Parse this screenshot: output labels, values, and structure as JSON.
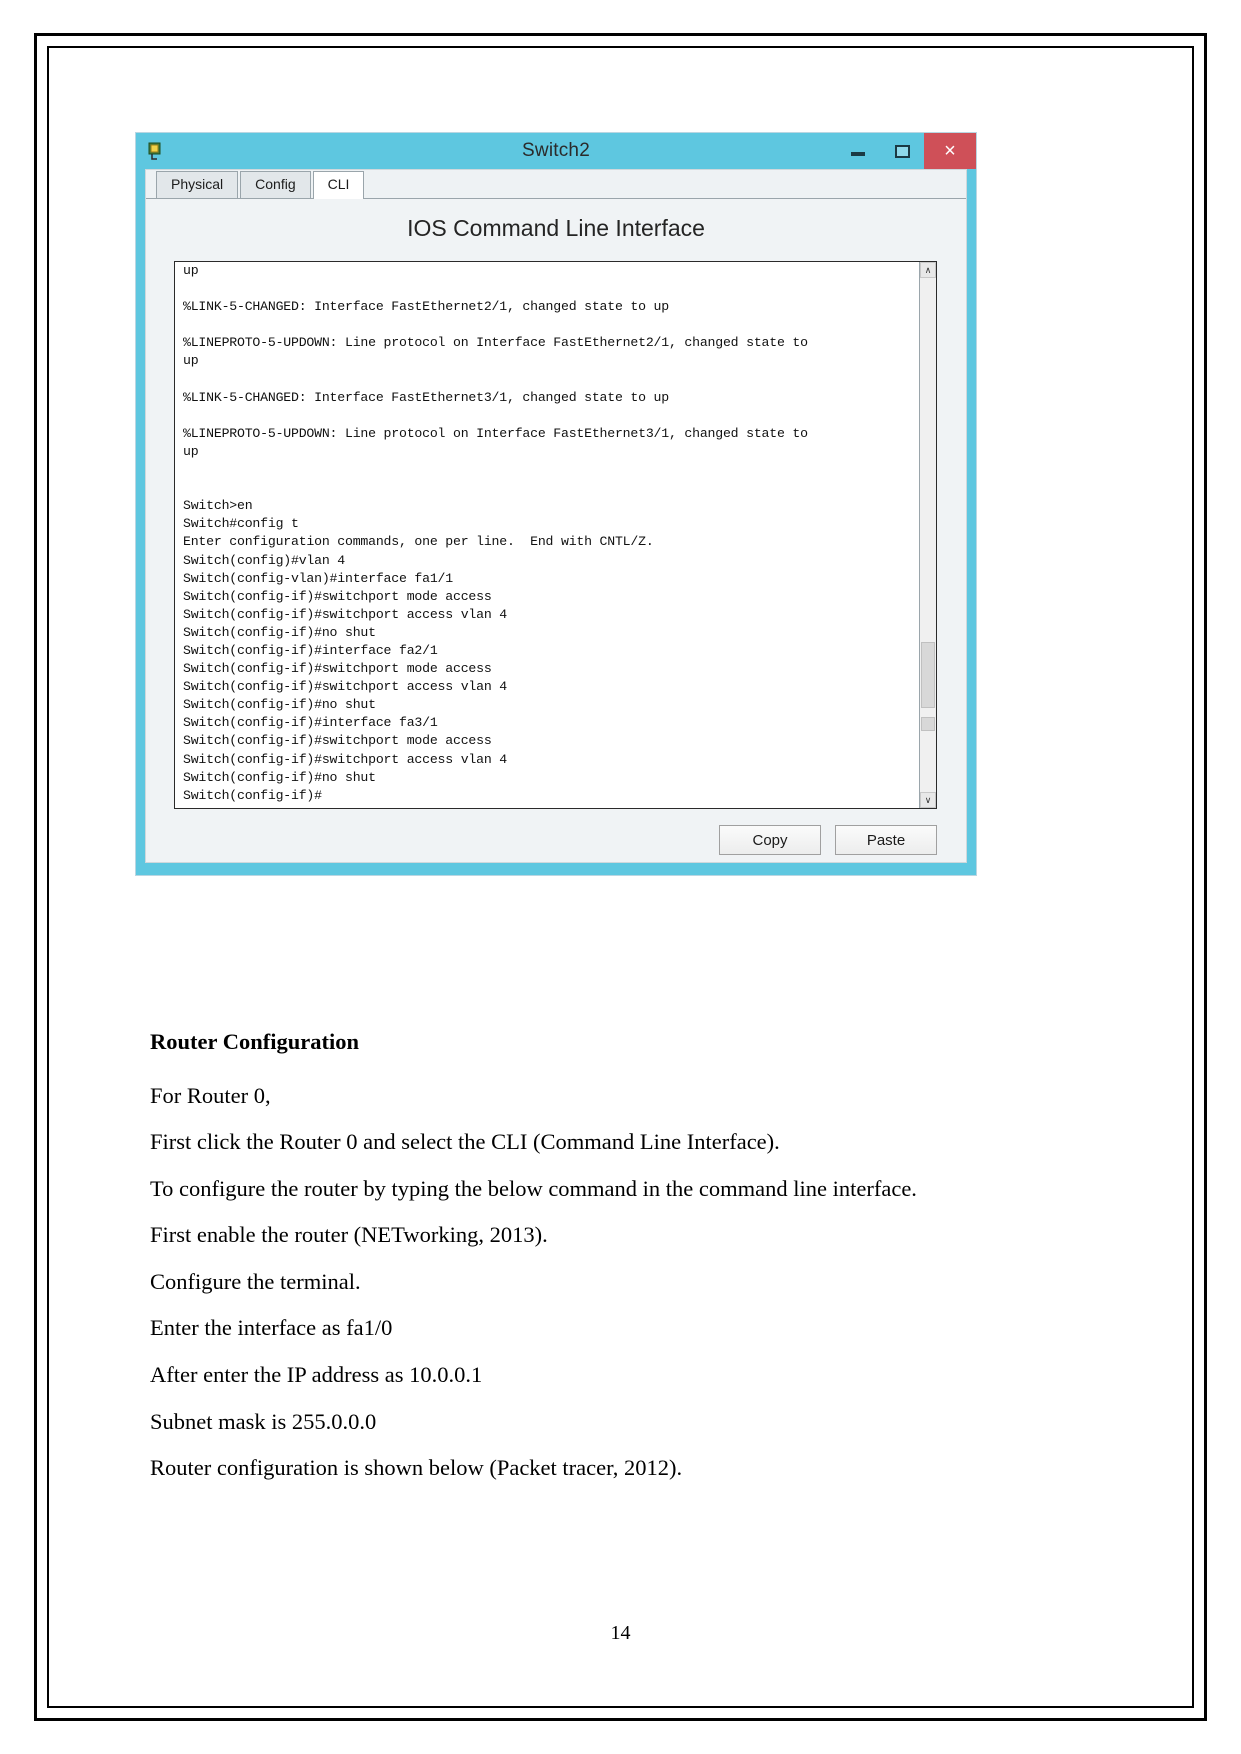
{
  "window": {
    "title": "Switch2",
    "icon": "packet-tracer-switch-icon",
    "controls": {
      "minimize": "–",
      "maximize": "□",
      "close": "×",
      "close_color": "#cf5058"
    },
    "titlebar_color": "#5ec7e0"
  },
  "tabs": [
    {
      "label": "Physical",
      "active": false
    },
    {
      "label": "Config",
      "active": false
    },
    {
      "label": "CLI",
      "active": true
    }
  ],
  "cli": {
    "heading": "IOS Command Line Interface",
    "terminal_text": "up\n\n%LINK-5-CHANGED: Interface FastEthernet2/1, changed state to up\n\n%LINEPROTO-5-UPDOWN: Line protocol on Interface FastEthernet2/1, changed state to\nup\n\n%LINK-5-CHANGED: Interface FastEthernet3/1, changed state to up\n\n%LINEPROTO-5-UPDOWN: Line protocol on Interface FastEthernet3/1, changed state to\nup\n\n\nSwitch>en\nSwitch#config t\nEnter configuration commands, one per line.  End with CNTL/Z.\nSwitch(config)#vlan 4\nSwitch(config-vlan)#interface fa1/1\nSwitch(config-if)#switchport mode access\nSwitch(config-if)#switchport access vlan 4\nSwitch(config-if)#no shut\nSwitch(config-if)#interface fa2/1\nSwitch(config-if)#switchport mode access\nSwitch(config-if)#switchport access vlan 4\nSwitch(config-if)#no shut\nSwitch(config-if)#interface fa3/1\nSwitch(config-if)#switchport mode access\nSwitch(config-if)#switchport access vlan 4\nSwitch(config-if)#no shut\nSwitch(config-if)#",
    "scrollbar": {
      "up_arrow": "∧",
      "down_arrow": "∨"
    },
    "buttons": {
      "copy": "Copy",
      "paste": "Paste"
    }
  },
  "article": {
    "heading": "Router Configuration",
    "paragraphs": [
      "For Router 0,",
      "First  click the Router 0 and select the CLI (Command Line Interface).",
      "To configure the router by typing the below command in the command line interface.",
      "First enable the router (NETworking, 2013).",
      "Configure the terminal.",
      "Enter the interface as fa1/0",
      "After enter the IP address as 10.0.0.1",
      "Subnet mask is 255.0.0.0",
      "Router configuration is shown below (Packet tracer, 2012)."
    ]
  },
  "page_number": "14"
}
